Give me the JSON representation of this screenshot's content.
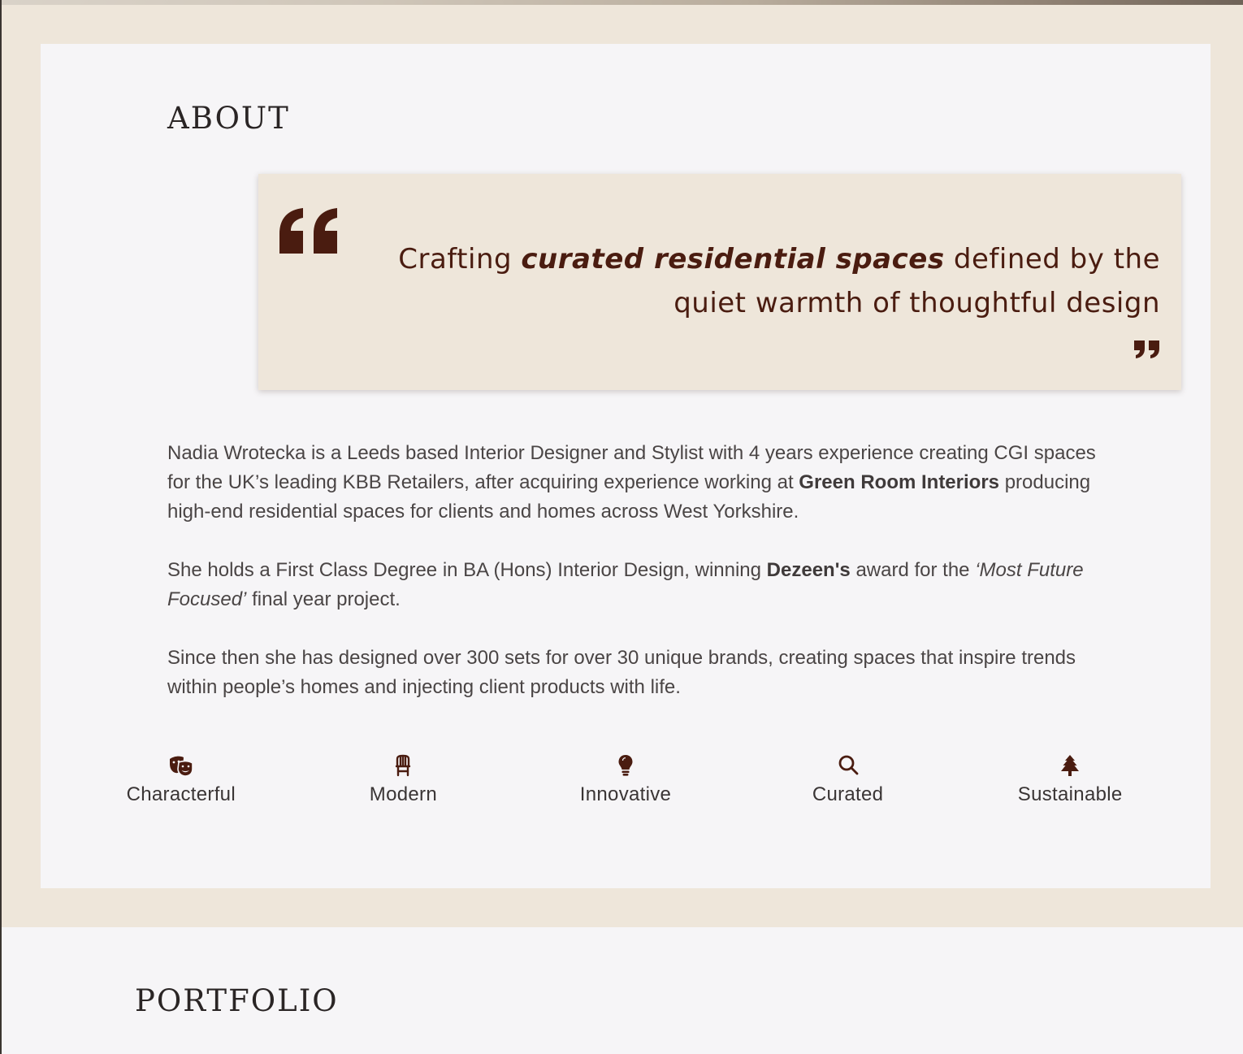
{
  "about": {
    "title": "ABOUT",
    "quote": {
      "prefix": "Crafting",
      "emphasis": "curated residential spaces",
      "suffix": "defined by the quiet warmth of thoughtful design",
      "open_icon": "quote-open-icon",
      "close_icon": "quote-close-icon"
    },
    "bio": {
      "p1_a": "Nadia Wrotecka is a Leeds based Interior Designer and Stylist with 4 years experience creating CGI spaces for the UK’s leading KBB Retailers, after acquiring experience working at",
      "p1_bold": "Green Room Interiors",
      "p1_b": "producing high-end residential spaces for clients and homes across West Yorkshire.",
      "p2_a": "She holds a First Class Degree in BA (Hons) Interior Design, winning",
      "p2_bold": "Dezeen's",
      "p2_b": "award for the",
      "p2_italic": "‘Most Future Focused’",
      "p2_c": "final year project.",
      "p3": "Since then she has designed over 300 sets for over 30 unique brands, creating spaces that inspire trends within people’s homes and injecting client products with life."
    },
    "values": [
      {
        "label": "Characterful",
        "icon": "theater-masks-icon"
      },
      {
        "label": "Modern",
        "icon": "chair-icon"
      },
      {
        "label": "Innovative",
        "icon": "lightbulb-icon"
      },
      {
        "label": "Curated",
        "icon": "search-icon"
      },
      {
        "label": "Sustainable",
        "icon": "tree-icon"
      }
    ]
  },
  "portfolio": {
    "title": "PORTFOLIO"
  },
  "colors": {
    "accent": "#4a1c10",
    "beige": "#eee6da",
    "card": "#f6f5f7",
    "text": "#4a4545"
  }
}
